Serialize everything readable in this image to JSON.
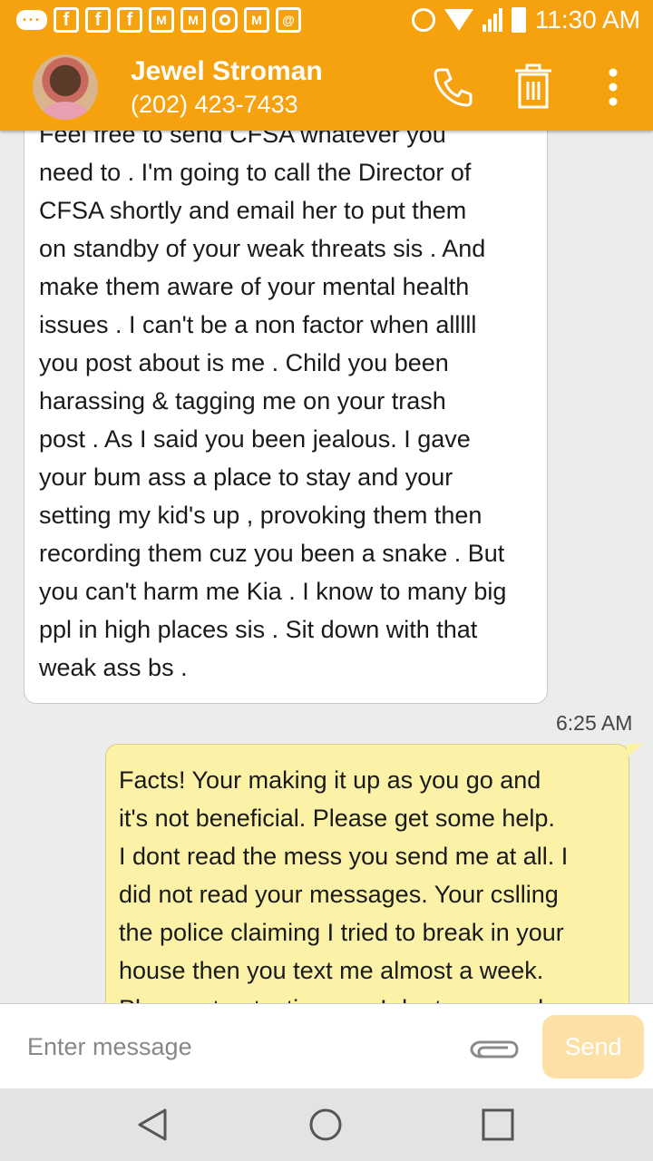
{
  "status_bar": {
    "time": "11:30 AM",
    "more_label": "···",
    "left_icons": [
      "facebook-icon",
      "facebook-icon",
      "facebook-icon",
      "gmail-icon",
      "gmail-icon",
      "instagram-icon",
      "gmail-icon",
      "email-icon"
    ],
    "right_icons": [
      "alarm-icon",
      "wifi-icon",
      "signal-icon",
      "battery-icon"
    ]
  },
  "header": {
    "contact_name": "Jewel Stroman",
    "contact_phone": "(202) 423-7433",
    "actions": [
      "phone-icon",
      "delete-icon",
      "more-vert-icon"
    ]
  },
  "messages": {
    "incoming": {
      "text": "one post , you tagged me on many sis .\nFeel free to send CFSA whatever you\nneed to . I'm going to call the Director of\nCFSA shortly and email her to put them\non standby of your weak threats sis . And\nmake them aware of your mental health\nissues . I can't be a non factor when alllll\nyou post about is me . Child you been\nharassing & tagging me on your trash\npost . As I said you been jealous.  I gave\nyour bum ass a place to stay and your\nsetting my kid's up , provoking them then\nrecording them cuz you been a snake . But\nyou can't harm me Kia . I know to many big\nppl in high places sis . Sit down with that\nweak ass bs .",
      "time": "6:25 AM"
    },
    "outgoing": {
      "text": "Facts! Your making it up as you go and\nit's not beneficial. Please get some help.\nI dont read the mess you send me at all. I\ndid not read your messages. Your cslling\nthe police claiming I tried to break in your\nhouse then you text me almost a week.\nPlease stop texting me. I dont care and"
    }
  },
  "composer": {
    "placeholder": "Enter message",
    "send_label": "Send"
  },
  "colors": {
    "accent": "#f6a10e",
    "outgoing_bubble": "#fbf2a8",
    "send_disabled": "#fde0a6"
  }
}
